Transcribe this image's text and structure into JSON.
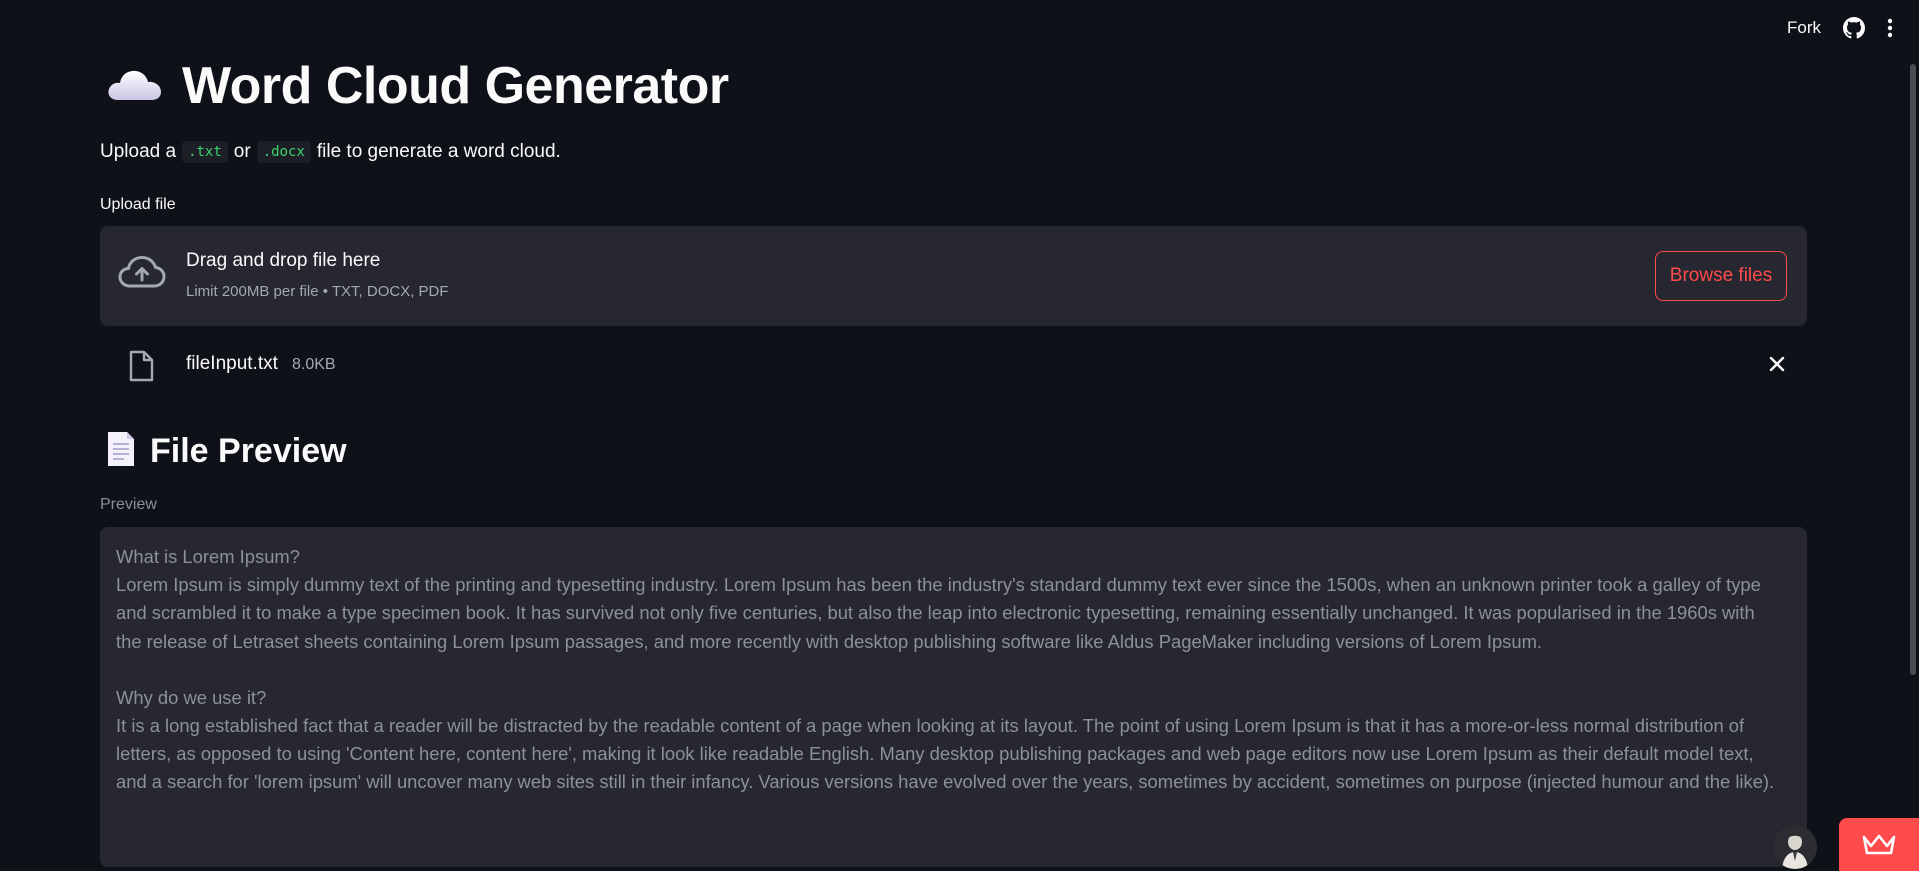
{
  "header": {
    "fork_label": "Fork"
  },
  "title": {
    "text": "Word Cloud Generator",
    "icon": "cloud-icon"
  },
  "subtitle": {
    "prefix": "Upload a",
    "code1": ".txt",
    "middle": "or",
    "code2": ".docx",
    "suffix": "file to generate a word cloud."
  },
  "uploader": {
    "label": "Upload file",
    "drag_text": "Drag and drop file here",
    "limit_text": "Limit 200MB per file • TXT, DOCX, PDF",
    "browse_label": "Browse files"
  },
  "uploaded_file": {
    "name": "fileInput.txt",
    "size": "8.0KB"
  },
  "preview_section": {
    "title": "File Preview",
    "icon": "page-icon",
    "label": "Preview",
    "paragraphs": [
      "What is Lorem Ipsum?\nLorem Ipsum is simply dummy text of the printing and typesetting industry. Lorem Ipsum has been the industry's standard dummy text ever since the 1500s, when an unknown printer took a galley of type and scrambled it to make a type specimen book. It has survived not only five centuries, but also the leap into electronic typesetting, remaining essentially unchanged. It was popularised in the 1960s with the release of Letraset sheets containing Lorem Ipsum passages, and more recently with desktop publishing software like Aldus PageMaker including versions of Lorem Ipsum.",
      "Why do we use it?\nIt is a long established fact that a reader will be distracted by the readable content of a page when looking at its layout. The point of using Lorem Ipsum is that it has a more-or-less normal distribution of letters, as opposed to using 'Content here, content here', making it look like readable English. Many desktop publishing packages and web page editors now use Lorem Ipsum as their default model text, and a search for 'lorem ipsum' will uncover many web sites still in their infancy. Various versions have evolved over the years, sometimes by accident, sometimes on purpose (injected humour and the like)."
    ]
  },
  "colors": {
    "background": "#0e1117",
    "surface": "#262730",
    "accent": "#ff4b4b",
    "code_text": "#3dd56d",
    "muted_text": "#a3a8b4"
  }
}
